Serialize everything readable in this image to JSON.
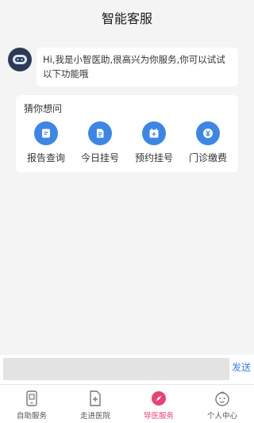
{
  "header": {
    "title": "智能客服"
  },
  "chat": {
    "message": "Hi,我是小智医助,很高兴为你服务,你可以试试以下功能哦"
  },
  "guess": {
    "title": "猜你想问",
    "items": [
      {
        "label": "报告查询",
        "icon": "report-icon"
      },
      {
        "label": "今日挂号",
        "icon": "document-icon"
      },
      {
        "label": "预约挂号",
        "icon": "calendar-plus-icon"
      },
      {
        "label": "门诊缴费",
        "icon": "yuan-coin-icon"
      }
    ]
  },
  "input": {
    "placeholder": "",
    "send_label": "发送"
  },
  "tabs": [
    {
      "label": "自助服务",
      "icon": "phone-icon",
      "active": false
    },
    {
      "label": "走进医院",
      "icon": "hospital-doc-icon",
      "active": false
    },
    {
      "label": "导医服务",
      "icon": "compass-icon",
      "active": true
    },
    {
      "label": "个人中心",
      "icon": "baby-face-icon",
      "active": false
    }
  ],
  "colors": {
    "accent_blue": "#3f86e4",
    "active_pink": "#e64573",
    "send_blue": "#3b7de0"
  }
}
